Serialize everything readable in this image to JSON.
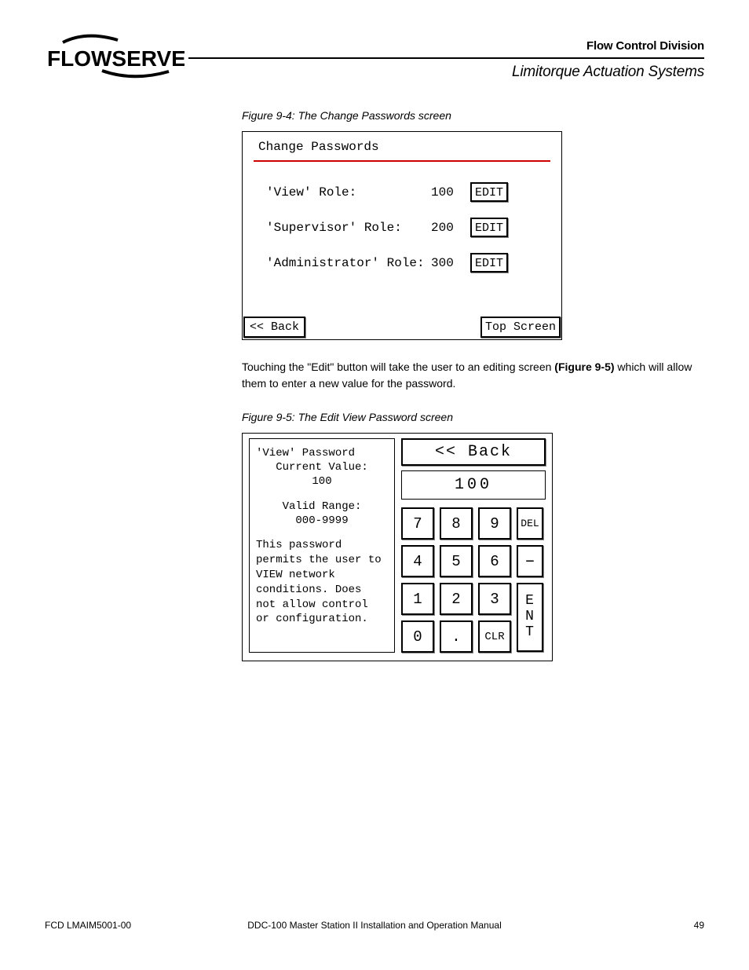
{
  "header": {
    "division": "Flow Control Division",
    "subheader": "Limitorque Actuation Systems",
    "logo_text": "FLOWSERVE"
  },
  "fig94": {
    "caption": "Figure 9-4: The Change Passwords screen",
    "title": "Change Passwords",
    "rows": [
      {
        "label": "'View' Role:",
        "value": "100",
        "edit": "EDIT"
      },
      {
        "label": "'Supervisor' Role:",
        "value": "200",
        "edit": "EDIT"
      },
      {
        "label": "'Administrator' Role:",
        "value": "300",
        "edit": "EDIT"
      }
    ],
    "back": "<< Back",
    "top": "Top Screen"
  },
  "paragraph": {
    "prefix": "Touching the \"Edit\" button will take the user to an editing screen ",
    "bold": "(Figure 9-5)",
    "suffix": " which will allow them to enter a new value for the password."
  },
  "fig95": {
    "caption": "Figure 9-5: The Edit View Password screen",
    "left": {
      "title": "'View' Password",
      "cv_label": "Current Value:",
      "cv_value": "100",
      "vr_label": "Valid Range:",
      "vr_value": "000-9999",
      "desc": "This password permits the user to VIEW network conditions. Does not allow control or configuration."
    },
    "right": {
      "back": "<< Back",
      "display": "100",
      "keys": [
        "7",
        "8",
        "9",
        "4",
        "5",
        "6",
        "1",
        "2",
        "3",
        "0",
        ".",
        "CLR"
      ],
      "del": "DEL",
      "minus": "–",
      "ent": [
        "E",
        "N",
        "T"
      ]
    }
  },
  "footer": {
    "left": "FCD LMAIM5001-00",
    "center": "DDC-100 Master Station II Installation and Operation Manual",
    "right": "49"
  }
}
